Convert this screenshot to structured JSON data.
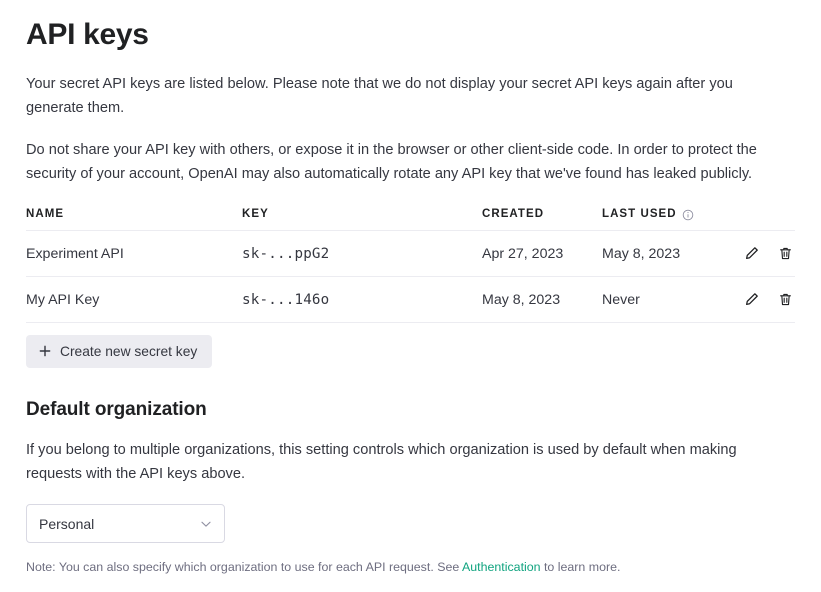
{
  "page": {
    "title": "API keys",
    "intro_paragraph": "Your secret API keys are listed below. Please note that we do not display your secret API keys again after you generate them.",
    "warning_paragraph": "Do not share your API key with others, or expose it in the browser or other client-side code. In order to protect the security of your account, OpenAI may also automatically rotate any API key that we've found has leaked publicly."
  },
  "table": {
    "headers": {
      "name": "NAME",
      "key": "KEY",
      "created": "CREATED",
      "last_used": "LAST USED"
    },
    "rows": [
      {
        "name": "Experiment API",
        "key": "sk-...ppG2",
        "created": "Apr 27, 2023",
        "last_used": "May 8, 2023"
      },
      {
        "name": "My API Key",
        "key": "sk-...146o",
        "created": "May 8, 2023",
        "last_used": "Never"
      }
    ]
  },
  "create_button": {
    "label": "Create new secret key"
  },
  "default_org": {
    "title": "Default organization",
    "description": "If you belong to multiple organizations, this setting controls which organization is used by default when making requests with the API keys above.",
    "select_value": "Personal",
    "note_before": "Note: You can also specify which organization to use for each API request. See ",
    "note_link": "Authentication",
    "note_after": " to learn more."
  },
  "colors": {
    "link": "#10a37f",
    "text": "#353740",
    "heading": "#202123",
    "button_bg": "#ececf1",
    "border": "#ececf1",
    "muted": "#6e6e80"
  }
}
